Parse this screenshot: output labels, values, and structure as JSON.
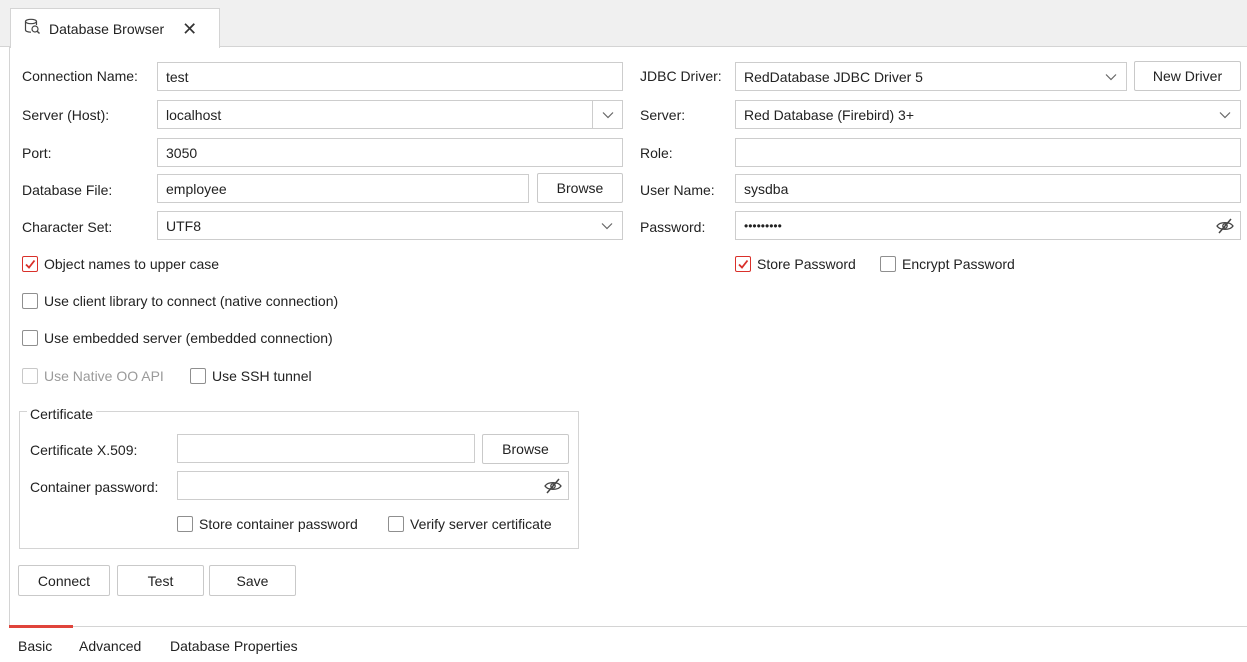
{
  "tab": {
    "title": "Database Browser",
    "close": "✕",
    "icon": "database-search-icon"
  },
  "left": {
    "connection_name": {
      "label": "Connection Name:",
      "value": "test"
    },
    "server_host": {
      "label": "Server (Host):",
      "value": "localhost"
    },
    "port": {
      "label": "Port:",
      "value": "3050"
    },
    "database_file": {
      "label": "Database File:",
      "value": "employee",
      "button": "Browse"
    },
    "character_set": {
      "label": "Character Set:",
      "value": "UTF8"
    },
    "checkboxes": {
      "upper_case": {
        "label": "Object names to upper case",
        "checked": true
      },
      "client_library": {
        "label": "Use client library to connect (native connection)",
        "checked": false
      },
      "embedded": {
        "label": "Use embedded server (embedded connection)",
        "checked": false
      },
      "native_oo": {
        "label": "Use Native OO API",
        "checked": false,
        "disabled": true
      },
      "ssh": {
        "label": "Use SSH tunnel",
        "checked": false
      }
    }
  },
  "right": {
    "jdbc_driver": {
      "label": "JDBC Driver:",
      "value": "RedDatabase JDBC Driver 5",
      "button": "New Driver"
    },
    "server": {
      "label": "Server:",
      "value": "Red Database (Firebird) 3+"
    },
    "role": {
      "label": "Role:",
      "value": ""
    },
    "user_name": {
      "label": "User Name:",
      "value": "sysdba"
    },
    "password": {
      "label": "Password:",
      "value": "•••••••••"
    },
    "store_password": {
      "label": "Store Password",
      "checked": true
    },
    "encrypt_password": {
      "label": "Encrypt Password",
      "checked": false
    }
  },
  "certificate": {
    "title": "Certificate",
    "x509": {
      "label": "Certificate X.509:",
      "value": "",
      "button": "Browse"
    },
    "container_password": {
      "label": "Container password:",
      "value": ""
    },
    "store_container_password": {
      "label": "Store container password",
      "checked": false
    },
    "verify_server_certificate": {
      "label": "Verify server certificate",
      "checked": false
    }
  },
  "actions": {
    "connect": "Connect",
    "test": "Test",
    "save": "Save"
  },
  "bottom_tabs": [
    "Basic",
    "Advanced",
    "Database Properties"
  ],
  "colors": {
    "accent": "#e0443b",
    "border": "#cdcdcd"
  }
}
